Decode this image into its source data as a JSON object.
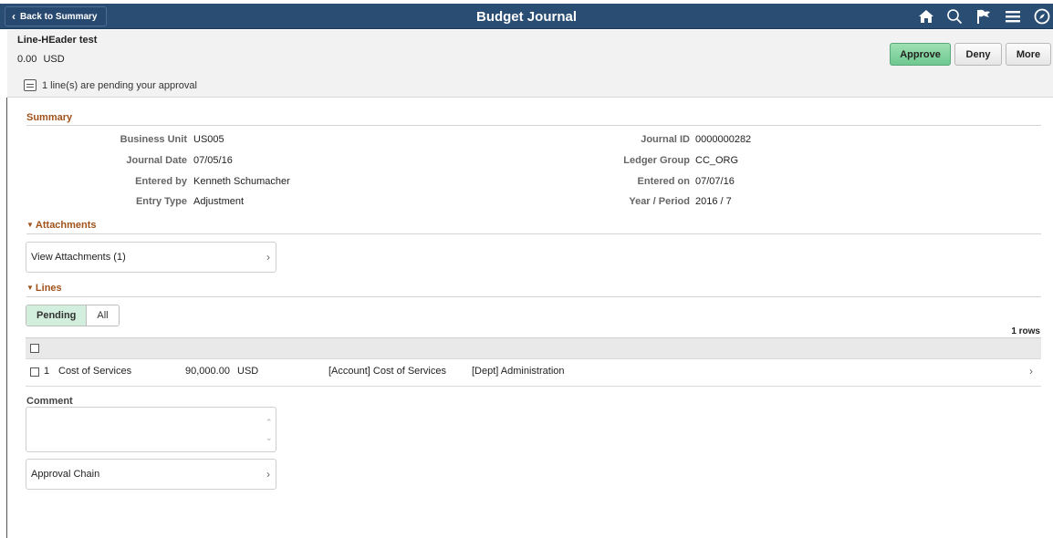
{
  "header": {
    "back_label": "Back to Summary",
    "title": "Budget Journal",
    "icons": [
      "home-icon",
      "search-icon",
      "flag-icon",
      "menu-icon",
      "navigator-icon"
    ]
  },
  "transaction": {
    "name": "Line-HEader test",
    "amount": "0.00",
    "currency": "USD",
    "pending_text": "1 line(s) are pending your approval"
  },
  "actions": {
    "approve": "Approve",
    "deny": "Deny",
    "more": "More"
  },
  "summary": {
    "heading": "Summary",
    "left": [
      {
        "label": "Business Unit",
        "value": "US005"
      },
      {
        "label": "Journal Date",
        "value": "07/05/16"
      },
      {
        "label": "Entered by",
        "value": "Kenneth Schumacher"
      },
      {
        "label": "Entry Type",
        "value": "Adjustment"
      }
    ],
    "right": [
      {
        "label": "Journal ID",
        "value": "0000000282"
      },
      {
        "label": "Ledger Group",
        "value": "CC_ORG"
      },
      {
        "label": "Entered on",
        "value": "07/07/16"
      },
      {
        "label": "Year / Period",
        "value": "2016 / 7"
      }
    ]
  },
  "attachments": {
    "heading": "Attachments",
    "view_label": "View Attachments (1)"
  },
  "lines": {
    "heading": "Lines",
    "tabs": [
      "Pending",
      "All"
    ],
    "active_tab": "Pending",
    "rows_count": "1 rows",
    "rows": [
      {
        "line_no": "1",
        "description": "Cost of Services",
        "amount": "90,000.00",
        "currency": "USD",
        "account": "[Account] Cost of Services",
        "dept": "[Dept] Administration"
      }
    ]
  },
  "comment": {
    "label": "Comment",
    "value": ""
  },
  "approval_chain": {
    "label": "Approval Chain"
  },
  "colors": {
    "header_bg": "#2a4d73",
    "approve_bg": "#8fd8a8",
    "section_heading": "#a0521a",
    "active_tab_bg": "#d2eedc"
  }
}
